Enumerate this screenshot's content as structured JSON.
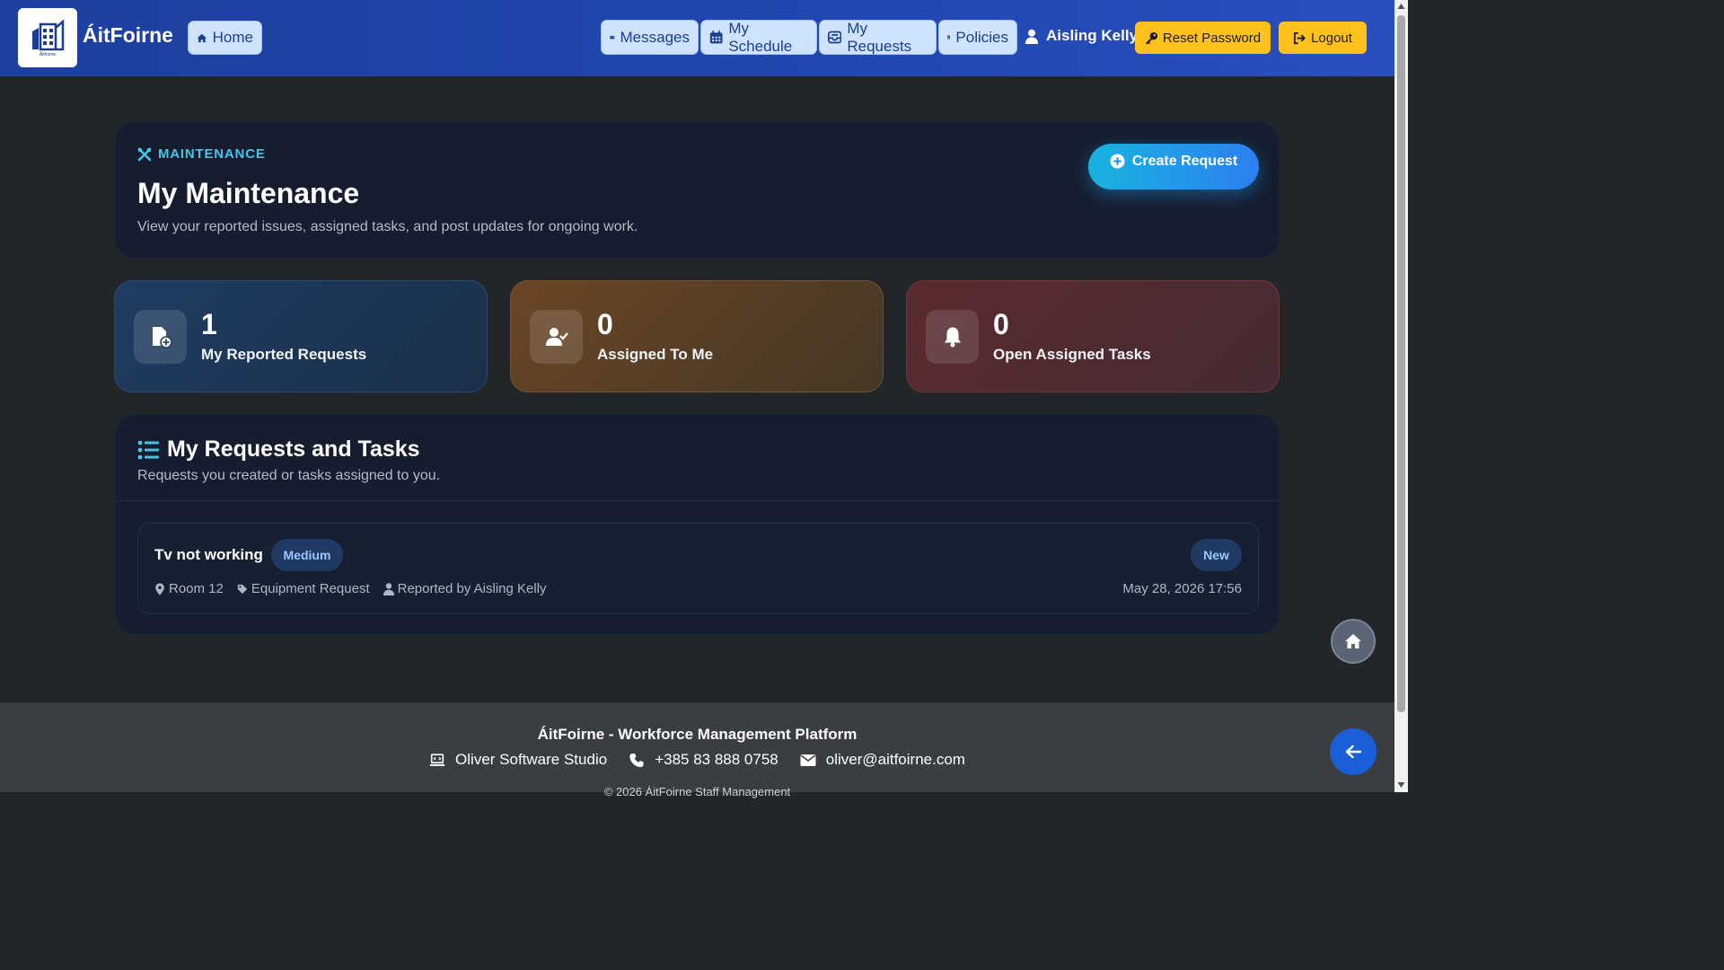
{
  "nav": {
    "brand": "ÁitFoirne",
    "logo_text": "Áitfoirne",
    "home": "Home",
    "messages": "Messages",
    "schedule": "My Schedule",
    "requests": "My Requests",
    "policies": "Policies",
    "user": "Aisling Kelly",
    "reset_password": "Reset Password",
    "logout": "Logout"
  },
  "hero": {
    "eyebrow": "MAINTENANCE",
    "title": "My Maintenance",
    "subtitle": "View your reported issues, assigned tasks, and post updates for ongoing work.",
    "create_button": "Create Request"
  },
  "stats": [
    {
      "value": "1",
      "label": "My Reported Requests",
      "icon": "file-plus-icon"
    },
    {
      "value": "0",
      "label": "Assigned To Me",
      "icon": "user-check-icon"
    },
    {
      "value": "0",
      "label": "Open Assigned Tasks",
      "icon": "bell-icon"
    }
  ],
  "list": {
    "title": "My Requests and Tasks",
    "subtitle": "Requests you created or tasks assigned to you.",
    "items": [
      {
        "title": "Tv not working",
        "priority": "Medium",
        "status": "New",
        "location": "Room 12",
        "category": "Equipment Request",
        "reporter": "Reported by Aisling Kelly",
        "date": "May 28, 2026 17:56"
      }
    ]
  },
  "footer": {
    "title": "ÁitFoirne - Workforce Management Platform",
    "company": "Oliver Software Studio",
    "phone": "+385 83 888 0758",
    "email": "oliver@aitfoirne.com",
    "copyright": "© 2026 ÁitFoirne Staff Management"
  },
  "colors": {
    "nav_bg": "#2147b0",
    "page_bg": "#222629",
    "card_bg": "#151d2e",
    "accent": "#46c4e8",
    "yellow": "#ffc21d",
    "badge_bg": "#1f3a63",
    "badge_text": "#9cc6ff"
  }
}
